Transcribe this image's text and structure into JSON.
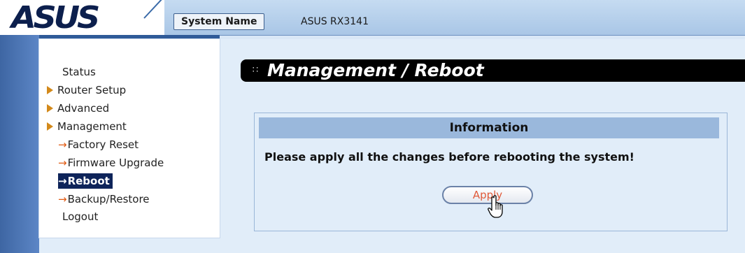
{
  "header": {
    "logo_text": "ASUS",
    "system_name_label": "System Name",
    "system_name_value": "ASUS RX3141"
  },
  "sidebar": {
    "items": [
      {
        "label": "Status",
        "type": "top"
      },
      {
        "label": "Router Setup",
        "type": "expandable",
        "icon": "triangle-right-icon"
      },
      {
        "label": "Advanced",
        "type": "expandable",
        "icon": "triangle-right-icon"
      },
      {
        "label": "Management",
        "type": "expandable",
        "icon": "triangle-right-icon"
      },
      {
        "label": "Factory Reset",
        "type": "sub",
        "icon": "arrow-right-icon"
      },
      {
        "label": "Firmware Upgrade",
        "type": "sub",
        "icon": "arrow-right-icon"
      },
      {
        "label": "Reboot",
        "type": "sub",
        "icon": "arrow-right-icon",
        "selected": true
      },
      {
        "label": "Backup/Restore",
        "type": "sub",
        "icon": "arrow-right-icon"
      },
      {
        "label": "Logout",
        "type": "top"
      }
    ],
    "sub_arrow_glyph": "→"
  },
  "main": {
    "title": "Management / Reboot",
    "title_icon": "bullet-icon",
    "info": {
      "header": "Information",
      "message": "Please apply all the changes before rebooting the system!",
      "apply_label": "Apply"
    }
  },
  "colors": {
    "header_bg": "#a9c6e6",
    "rail": "#3e66a3",
    "selected_item_bg": "#0e245a",
    "menu_arrow": "#d3891a",
    "info_header_bg": "#9ab8dc",
    "apply_text": "#e05a3a"
  }
}
